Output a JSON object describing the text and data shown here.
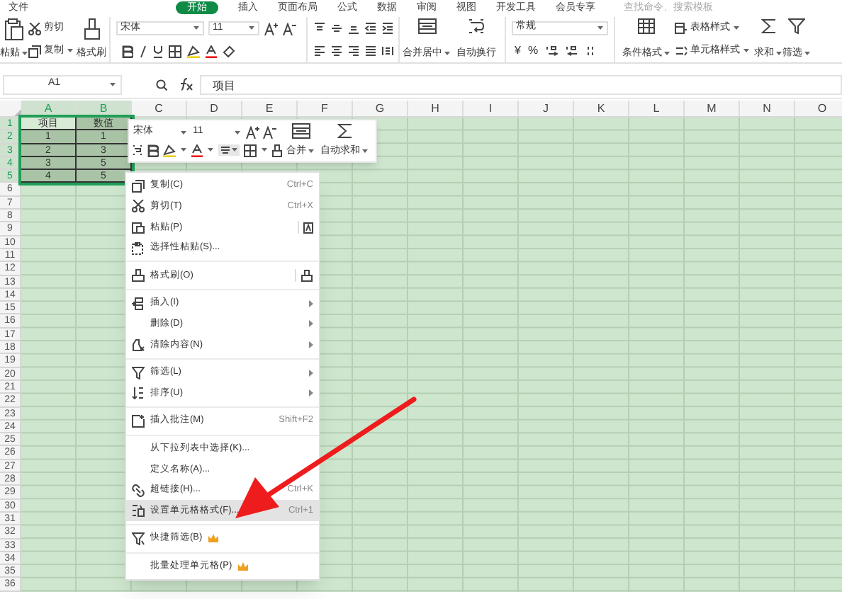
{
  "menu_tabs": [
    {
      "label": "文件",
      "selected": false
    },
    {
      "label": "开始",
      "selected": true
    },
    {
      "label": "插入",
      "selected": false
    },
    {
      "label": "页面布局",
      "selected": false
    },
    {
      "label": "公式",
      "selected": false
    },
    {
      "label": "数据",
      "selected": false
    },
    {
      "label": "审阅",
      "selected": false
    },
    {
      "label": "视图",
      "selected": false
    },
    {
      "label": "开发工具",
      "selected": false
    },
    {
      "label": "会员专享",
      "selected": false
    }
  ],
  "command_search": {
    "placeholder": "查找命令、搜索模板"
  },
  "ribbon": {
    "paste": "粘贴",
    "cut": "剪切",
    "copy": "复制",
    "format_painter": "格式刷",
    "font": "宋体",
    "font_size": "11",
    "merge": "合并居中",
    "wrap": "自动换行",
    "number_format": "常规",
    "currency": "¥",
    "percent": "%",
    "conditional_format": "条件格式",
    "table_style": "表格样式",
    "cell_style": "单元格样式",
    "sum": "求和",
    "filter": "筛选"
  },
  "formula_bar": {
    "name_box": "A1",
    "value": "项目"
  },
  "sheet": {
    "columns": [
      {
        "label": "A",
        "selected": true
      },
      {
        "label": "B",
        "selected": true
      },
      {
        "label": "C",
        "selected": false
      },
      {
        "label": "D",
        "selected": false
      },
      {
        "label": "E",
        "selected": false
      },
      {
        "label": "F",
        "selected": false
      },
      {
        "label": "G",
        "selected": false
      },
      {
        "label": "H",
        "selected": false
      },
      {
        "label": "I",
        "selected": false
      },
      {
        "label": "J",
        "selected": false
      },
      {
        "label": "K",
        "selected": false
      },
      {
        "label": "L",
        "selected": false
      },
      {
        "label": "M",
        "selected": false
      },
      {
        "label": "N",
        "selected": false
      },
      {
        "label": "O",
        "selected": false
      }
    ],
    "rows": [
      {
        "label": "1",
        "selected": true
      },
      {
        "label": "2",
        "selected": true
      },
      {
        "label": "3",
        "selected": true
      },
      {
        "label": "4",
        "selected": true
      },
      {
        "label": "5",
        "selected": true
      },
      {
        "label": "6",
        "selected": false
      },
      {
        "label": "7",
        "selected": false
      },
      {
        "label": "8",
        "selected": false
      },
      {
        "label": "9",
        "selected": false
      },
      {
        "label": "10",
        "selected": false
      },
      {
        "label": "11",
        "selected": false
      },
      {
        "label": "12",
        "selected": false
      },
      {
        "label": "13",
        "selected": false
      },
      {
        "label": "14",
        "selected": false
      },
      {
        "label": "15",
        "selected": false
      },
      {
        "label": "16",
        "selected": false
      },
      {
        "label": "17",
        "selected": false
      },
      {
        "label": "18",
        "selected": false
      },
      {
        "label": "19",
        "selected": false
      },
      {
        "label": "20",
        "selected": false
      },
      {
        "label": "21",
        "selected": false
      },
      {
        "label": "22",
        "selected": false
      },
      {
        "label": "23",
        "selected": false
      },
      {
        "label": "24",
        "selected": false
      },
      {
        "label": "25",
        "selected": false
      },
      {
        "label": "26",
        "selected": false
      },
      {
        "label": "27",
        "selected": false
      },
      {
        "label": "28",
        "selected": false
      },
      {
        "label": "29",
        "selected": false
      },
      {
        "label": "30",
        "selected": false
      },
      {
        "label": "31",
        "selected": false
      },
      {
        "label": "32",
        "selected": false
      },
      {
        "label": "33",
        "selected": false
      },
      {
        "label": "34",
        "selected": false
      },
      {
        "label": "35",
        "selected": false
      },
      {
        "label": "36",
        "selected": false
      }
    ],
    "data": [
      [
        "项目",
        "数值"
      ],
      [
        "1",
        "1"
      ],
      [
        "2",
        "3"
      ],
      [
        "3",
        "5"
      ],
      [
        "4",
        "5"
      ]
    ]
  },
  "mini_toolbar": {
    "font": "宋体",
    "font_size": "11",
    "merge": "合并",
    "auto_sum": "自动求和"
  },
  "context_menu": [
    {
      "kind": "item",
      "label": "复制(C)",
      "shortcut": "Ctrl+C",
      "submenu": false,
      "premium": false,
      "selected": false
    },
    {
      "kind": "item",
      "label": "剪切(T)",
      "shortcut": "Ctrl+X",
      "submenu": false,
      "premium": false,
      "selected": false
    },
    {
      "kind": "item",
      "label": "粘贴(P)",
      "submenu": false,
      "premium": false,
      "selected": false
    },
    {
      "kind": "item",
      "label": "选择性粘贴(S)...",
      "submenu": false,
      "premium": false,
      "selected": false
    },
    {
      "kind": "separator"
    },
    {
      "kind": "item",
      "label": "格式刷(O)",
      "submenu": false,
      "premium": false,
      "selected": false
    },
    {
      "kind": "separator"
    },
    {
      "kind": "item",
      "label": "插入(I)",
      "submenu": true,
      "premium": false,
      "selected": false
    },
    {
      "kind": "item",
      "label": "删除(D)",
      "submenu": true,
      "premium": false,
      "selected": false
    },
    {
      "kind": "item",
      "label": "清除内容(N)",
      "submenu": true,
      "premium": false,
      "selected": false
    },
    {
      "kind": "separator"
    },
    {
      "kind": "item",
      "label": "筛选(L)",
      "submenu": true,
      "premium": false,
      "selected": false
    },
    {
      "kind": "item",
      "label": "排序(U)",
      "submenu": true,
      "premium": false,
      "selected": false
    },
    {
      "kind": "separator"
    },
    {
      "kind": "item",
      "label": "插入批注(M)",
      "shortcut": "Shift+F2",
      "submenu": false,
      "premium": false,
      "selected": false
    },
    {
      "kind": "separator"
    },
    {
      "kind": "item",
      "label": "从下拉列表中选择(K)...",
      "submenu": false,
      "premium": false,
      "selected": false
    },
    {
      "kind": "item",
      "label": "定义名称(A)...",
      "submenu": false,
      "premium": false,
      "selected": false
    },
    {
      "kind": "item",
      "label": "超链接(H)...",
      "shortcut": "Ctrl+K",
      "submenu": false,
      "premium": false,
      "selected": false
    },
    {
      "kind": "item",
      "label": "设置单元格格式(F)...",
      "shortcut": "Ctrl+1",
      "submenu": false,
      "premium": false,
      "selected": true
    },
    {
      "kind": "separator"
    },
    {
      "kind": "item",
      "label": "快捷筛选(B)",
      "submenu": false,
      "premium": true,
      "selected": false
    },
    {
      "kind": "separator"
    },
    {
      "kind": "item",
      "label": "批量处理单元格(P)",
      "submenu": false,
      "premium": true,
      "selected": false
    }
  ]
}
